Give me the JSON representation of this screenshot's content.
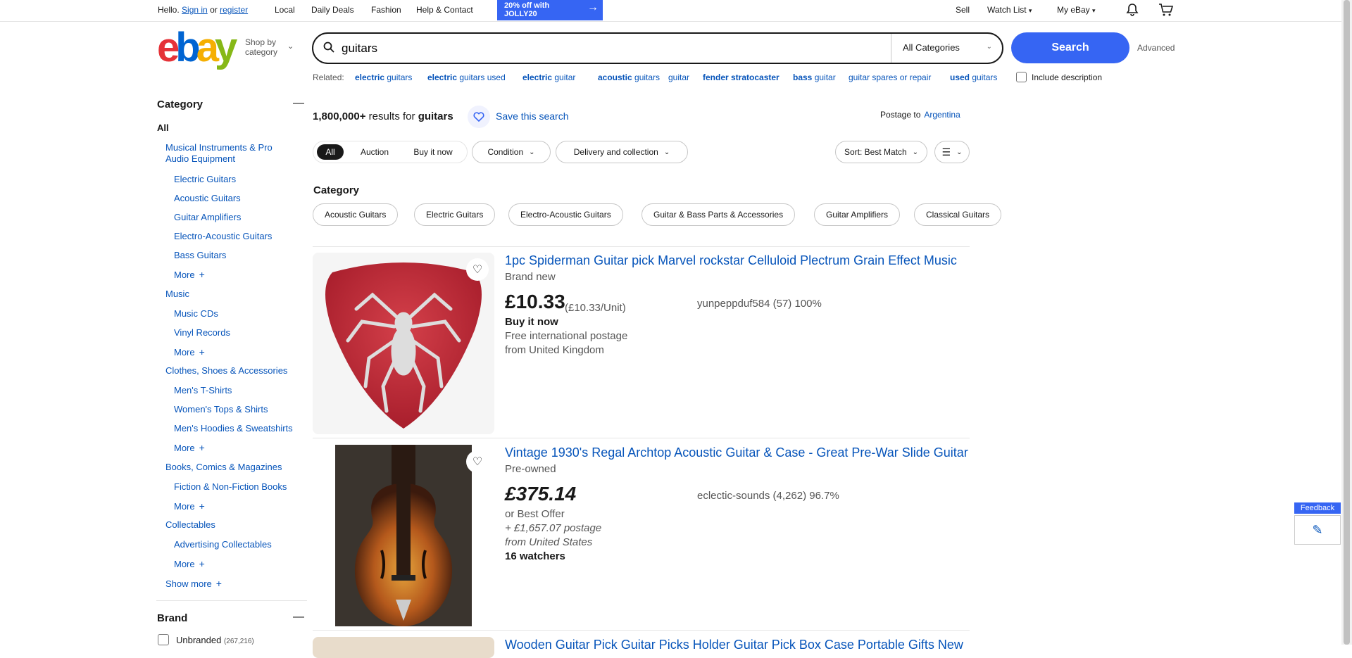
{
  "topbar": {
    "hello": "Hello.",
    "sign_in": "Sign in",
    "or": "or",
    "register": "register",
    "local": "Local",
    "daily_deals": "Daily Deals",
    "fashion": "Fashion",
    "help_contact": "Help & Contact",
    "promo_line1": "20% off with",
    "promo_line2": "JOLLY20",
    "sell": "Sell",
    "watch_list": "Watch List",
    "my_ebay": "My eBay"
  },
  "header": {
    "logo": [
      "e",
      "b",
      "a",
      "y"
    ],
    "shop_by_line1": "Shop by",
    "shop_by_line2": "category",
    "search_value": "guitars",
    "category_select": "All Categories",
    "search_button": "Search",
    "advanced": "Advanced"
  },
  "related": {
    "label": "Related:",
    "items": [
      {
        "bold": "electric",
        "rest": " guitars"
      },
      {
        "bold": "electric",
        "rest": " guitars used"
      },
      {
        "bold": "electric",
        "rest": " guitar"
      },
      {
        "bold": "acoustic",
        "rest": " guitars"
      },
      {
        "bold": "",
        "rest": "guitar"
      },
      {
        "bold": "fender stratocaster",
        "rest": ""
      },
      {
        "bold": "bass",
        "rest": " guitar"
      },
      {
        "bold": "",
        "rest": "guitar spares or repair"
      },
      {
        "bold": "used",
        "rest": " guitars"
      }
    ],
    "include_description": "Include description"
  },
  "sidebar": {
    "category_heading": "Category",
    "all": "All",
    "groups": [
      {
        "title": "Musical Instruments & Pro Audio Equipment",
        "items": [
          "Electric Guitars",
          "Acoustic Guitars",
          "Guitar Amplifiers",
          "Electro-Acoustic Guitars",
          "Bass Guitars"
        ],
        "more": "More"
      },
      {
        "title": "Music",
        "items": [
          "Music CDs",
          "Vinyl Records"
        ],
        "more": "More"
      },
      {
        "title": "Clothes, Shoes & Accessories",
        "items": [
          "Men's T-Shirts",
          "Women's Tops & Shirts",
          "Men's Hoodies & Sweatshirts"
        ],
        "more": "More"
      },
      {
        "title": "Books, Comics & Magazines",
        "items": [
          "Fiction & Non-Fiction Books"
        ],
        "more": "More"
      },
      {
        "title": "Collectables",
        "items": [
          "Advertising Collectables"
        ],
        "more": "More"
      }
    ],
    "show_more": "Show more",
    "brand_heading": "Brand",
    "brand_first": "Unbranded",
    "brand_first_count": "(267,216)"
  },
  "results": {
    "count": "1,800,000+",
    "results_for": " results for ",
    "query": "guitars",
    "save_search": "Save this search",
    "postage_to": "Postage to",
    "country": "Argentina",
    "tabs": [
      "All",
      "Auction",
      "Buy it now"
    ],
    "filters": [
      "Condition",
      "Delivery and collection"
    ],
    "sort": "Sort: Best Match",
    "category_label": "Category",
    "category_chips": [
      "Acoustic Guitars",
      "Electric Guitars",
      "Electro-Acoustic Guitars",
      "Guitar & Bass Parts & Accessories",
      "Guitar Amplifiers",
      "Classical Guitars"
    ]
  },
  "listings": [
    {
      "title": "1pc Spiderman Guitar pick Marvel rockstar Celluloid Plectrum Grain Effect Music",
      "condition": "Brand new",
      "price": "£10.33",
      "unit_price": "(£10.33/Unit)",
      "format": "Buy it now",
      "postage": "Free international postage",
      "from": "from United Kingdom",
      "seller": "yunpeppduf584 (57) 100%"
    },
    {
      "title": "Vintage 1930's Regal Archtop Acoustic Guitar & Case - Great Pre-War Slide Guitar",
      "condition": "Pre-owned",
      "price": "£375.14",
      "format": "or Best Offer",
      "postage": "+ £1,657.07 postage",
      "from": "from United States",
      "watchers": "16 watchers",
      "seller": "eclectic-sounds (4,262) 96.7%"
    },
    {
      "title": "Wooden Guitar Pick Guitar Picks Holder Guitar Pick Box Case Portable Gifts New"
    }
  ],
  "feedback": "Feedback",
  "colors": {
    "blue": "#3665f3",
    "link": "#0654ba",
    "red": "#e53238",
    "logo_blue": "#0064d2",
    "yellow": "#f5af02",
    "green": "#86b817"
  }
}
